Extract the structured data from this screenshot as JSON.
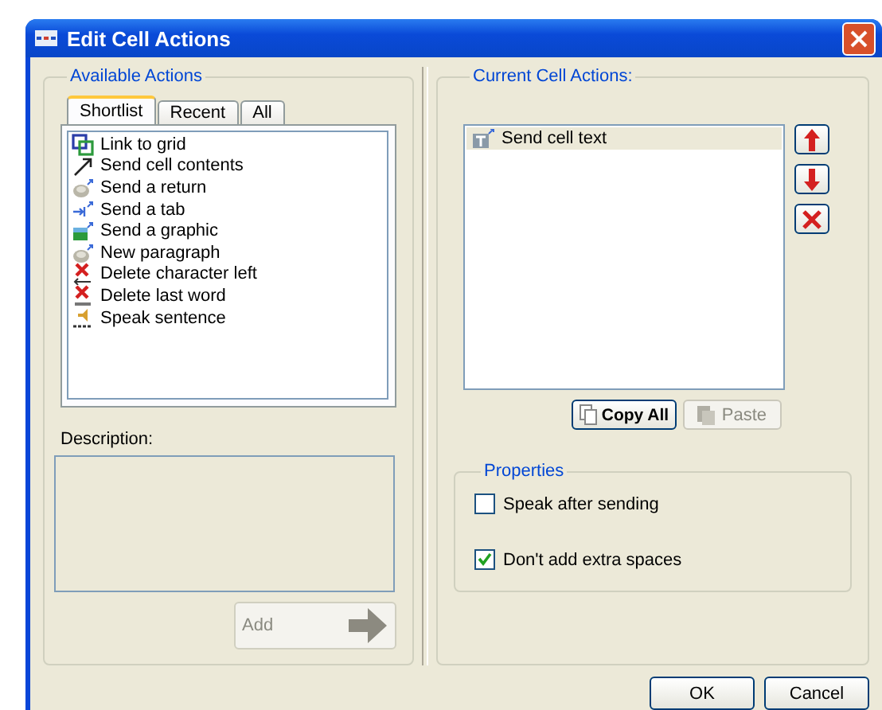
{
  "window": {
    "title": "Edit Cell Actions"
  },
  "available_actions": {
    "title": "Available Actions",
    "tabs": [
      {
        "label": "Shortlist",
        "selected": true
      },
      {
        "label": "Recent",
        "selected": false
      },
      {
        "label": "All",
        "selected": false
      }
    ],
    "items": [
      {
        "label": "Link to grid"
      },
      {
        "label": "Send cell contents"
      },
      {
        "label": "Send a return"
      },
      {
        "label": "Send a tab"
      },
      {
        "label": "Send a graphic"
      },
      {
        "label": "New paragraph"
      },
      {
        "label": "Delete character left"
      },
      {
        "label": "Delete last word"
      },
      {
        "label": "Speak sentence"
      }
    ],
    "description_label": "Description:",
    "add_button": {
      "label": "Add",
      "disabled": true
    }
  },
  "current_cell_actions": {
    "title": "Current Cell Actions:",
    "items": [
      {
        "label": "Send cell text",
        "selected": true
      }
    ],
    "copy_all_button": {
      "label": "Copy All",
      "disabled": false
    },
    "paste_button": {
      "label": "Paste",
      "disabled": true
    }
  },
  "properties": {
    "title": "Properties",
    "options": [
      {
        "label": "Speak after sending",
        "checked": false
      },
      {
        "label": "Don't add extra spaces",
        "checked": true
      }
    ]
  },
  "buttons": [
    {
      "label": "OK"
    },
    {
      "label": "Cancel"
    }
  ]
}
